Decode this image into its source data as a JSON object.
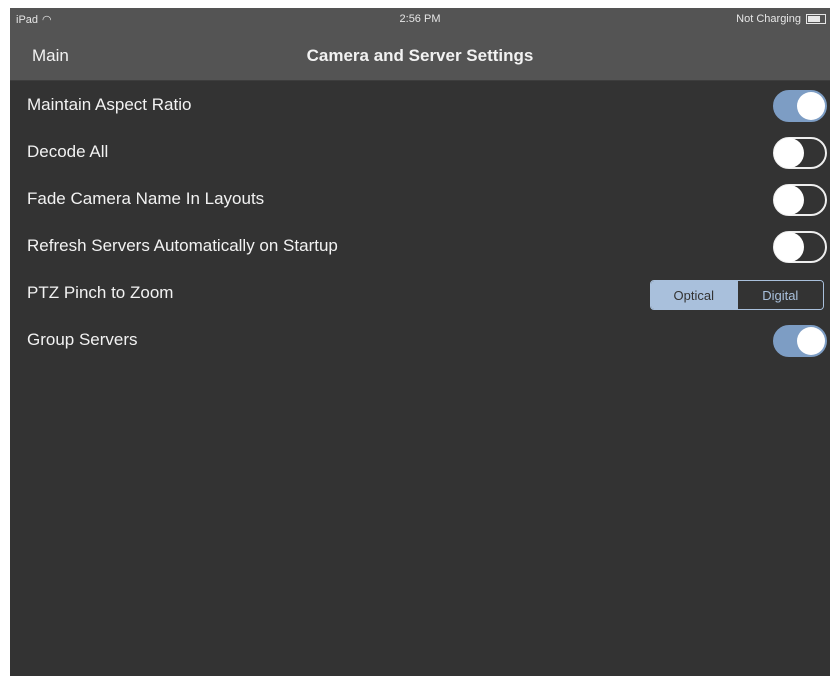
{
  "status_bar": {
    "device": "iPad",
    "wifi_icon": "wifi-icon",
    "time": "2:56 PM",
    "battery_text": "Not Charging",
    "battery_icon": "battery-icon"
  },
  "nav": {
    "back_label": "Main",
    "title": "Camera and Server Settings"
  },
  "settings": [
    {
      "label": "Maintain Aspect Ratio",
      "control": "toggle",
      "on": true
    },
    {
      "label": "Decode All",
      "control": "toggle",
      "on": false
    },
    {
      "label": "Fade Camera Name In Layouts",
      "control": "toggle",
      "on": false
    },
    {
      "label": "Refresh Servers Automatically on Startup",
      "control": "toggle",
      "on": false
    },
    {
      "label": "PTZ Pinch to Zoom",
      "control": "segmented",
      "options": [
        "Optical",
        "Digital"
      ],
      "selected": "Optical"
    },
    {
      "label": "Group Servers",
      "control": "toggle",
      "on": true
    }
  ],
  "colors": {
    "accent": "#7d9dc4",
    "background": "#333333",
    "bar": "#545454"
  }
}
